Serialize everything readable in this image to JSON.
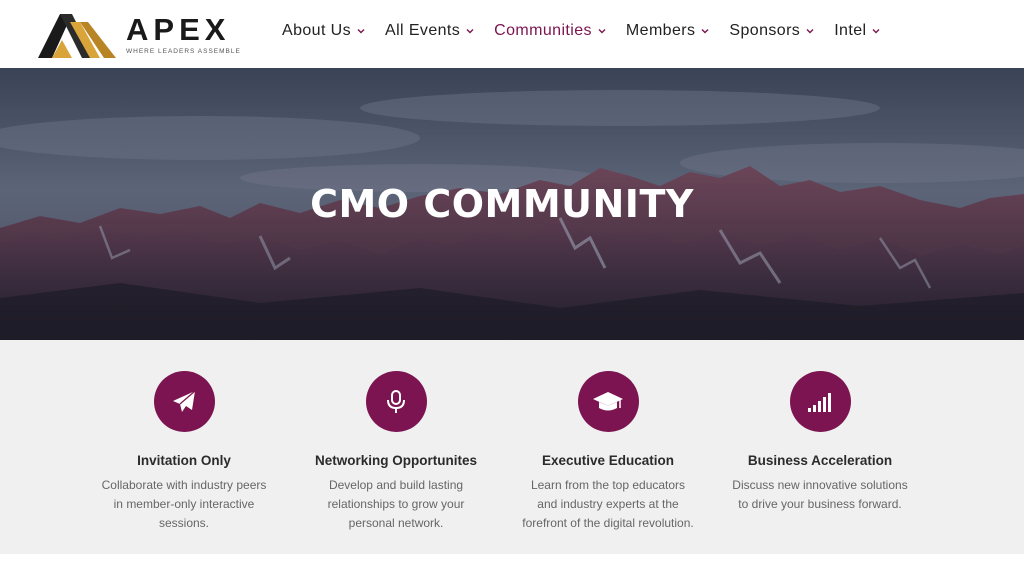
{
  "brand": {
    "name": "APEX",
    "tagline": "WHERE LEADERS ASSEMBLE",
    "colors": {
      "accent": "#7b1450",
      "logo_gold": "#d9a53a",
      "logo_dark": "#1a1a1a"
    }
  },
  "nav": {
    "items": [
      {
        "label": "About Us",
        "active": false
      },
      {
        "label": "All Events",
        "active": false
      },
      {
        "label": "Communities",
        "active": true
      },
      {
        "label": "Members",
        "active": false
      },
      {
        "label": "Sponsors",
        "active": false
      },
      {
        "label": "Intel",
        "active": false
      }
    ]
  },
  "hero": {
    "title": "CMO COMMUNITY"
  },
  "features": [
    {
      "icon": "paper-plane-icon",
      "title": "Invitation Only",
      "desc": [
        "Collaborate with industry peers",
        "in member-only interactive",
        "sessions."
      ]
    },
    {
      "icon": "microphone-icon",
      "title": "Networking Opportunites",
      "desc": [
        "Develop and build lasting",
        "relationships to grow your",
        "personal network."
      ]
    },
    {
      "icon": "graduation-cap-icon",
      "title": "Executive Education",
      "desc": [
        "Learn from the top educators",
        "and industry experts at the",
        "forefront of the digital revolution."
      ]
    },
    {
      "icon": "signal-bars-icon",
      "title": "Business Acceleration",
      "desc": [
        "Discuss new innovative solutions",
        "to drive your business forward."
      ]
    }
  ]
}
